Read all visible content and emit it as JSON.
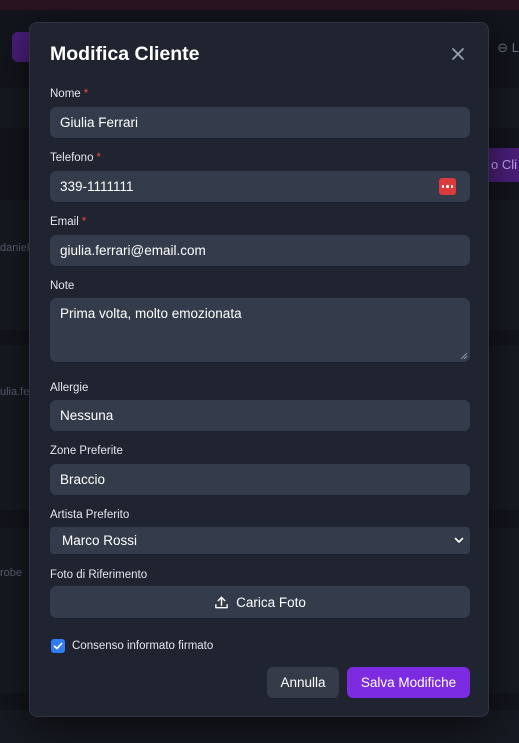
{
  "background": {
    "right_button_label": "o Cli",
    "right_link_label": "⊖ L",
    "peek_names": [
      "daniel",
      "ulia.fe",
      "robe"
    ]
  },
  "modal": {
    "title": "Modifica Cliente",
    "close_icon": "close-icon",
    "fields": {
      "nome": {
        "label": "Nome",
        "required_mark": "*",
        "value": "Giulia Ferrari"
      },
      "telefono": {
        "label": "Telefono",
        "required_mark": "*",
        "value": "339-1111111",
        "icon": "password-manager-icon"
      },
      "email": {
        "label": "Email",
        "required_mark": "*",
        "value": "giulia.ferrari@email.com"
      },
      "note": {
        "label": "Note",
        "value": "Prima volta, molto emozionata"
      },
      "allergie": {
        "label": "Allergie",
        "value": "Nessuna"
      },
      "zone": {
        "label": "Zone Preferite",
        "value": "Braccio"
      },
      "artista": {
        "label": "Artista Preferito",
        "selected": "Marco Rossi"
      },
      "foto": {
        "label": "Foto di Riferimento",
        "button_label": "Carica Foto",
        "icon": "upload-icon"
      }
    },
    "consent": {
      "label": "Consenso informato firmato",
      "checked": true
    },
    "buttons": {
      "cancel": "Annulla",
      "save": "Salva Modifiche"
    }
  },
  "colors": {
    "accent": "#7c2be0",
    "required": "#ef4444",
    "checkbox": "#2f7df6"
  }
}
